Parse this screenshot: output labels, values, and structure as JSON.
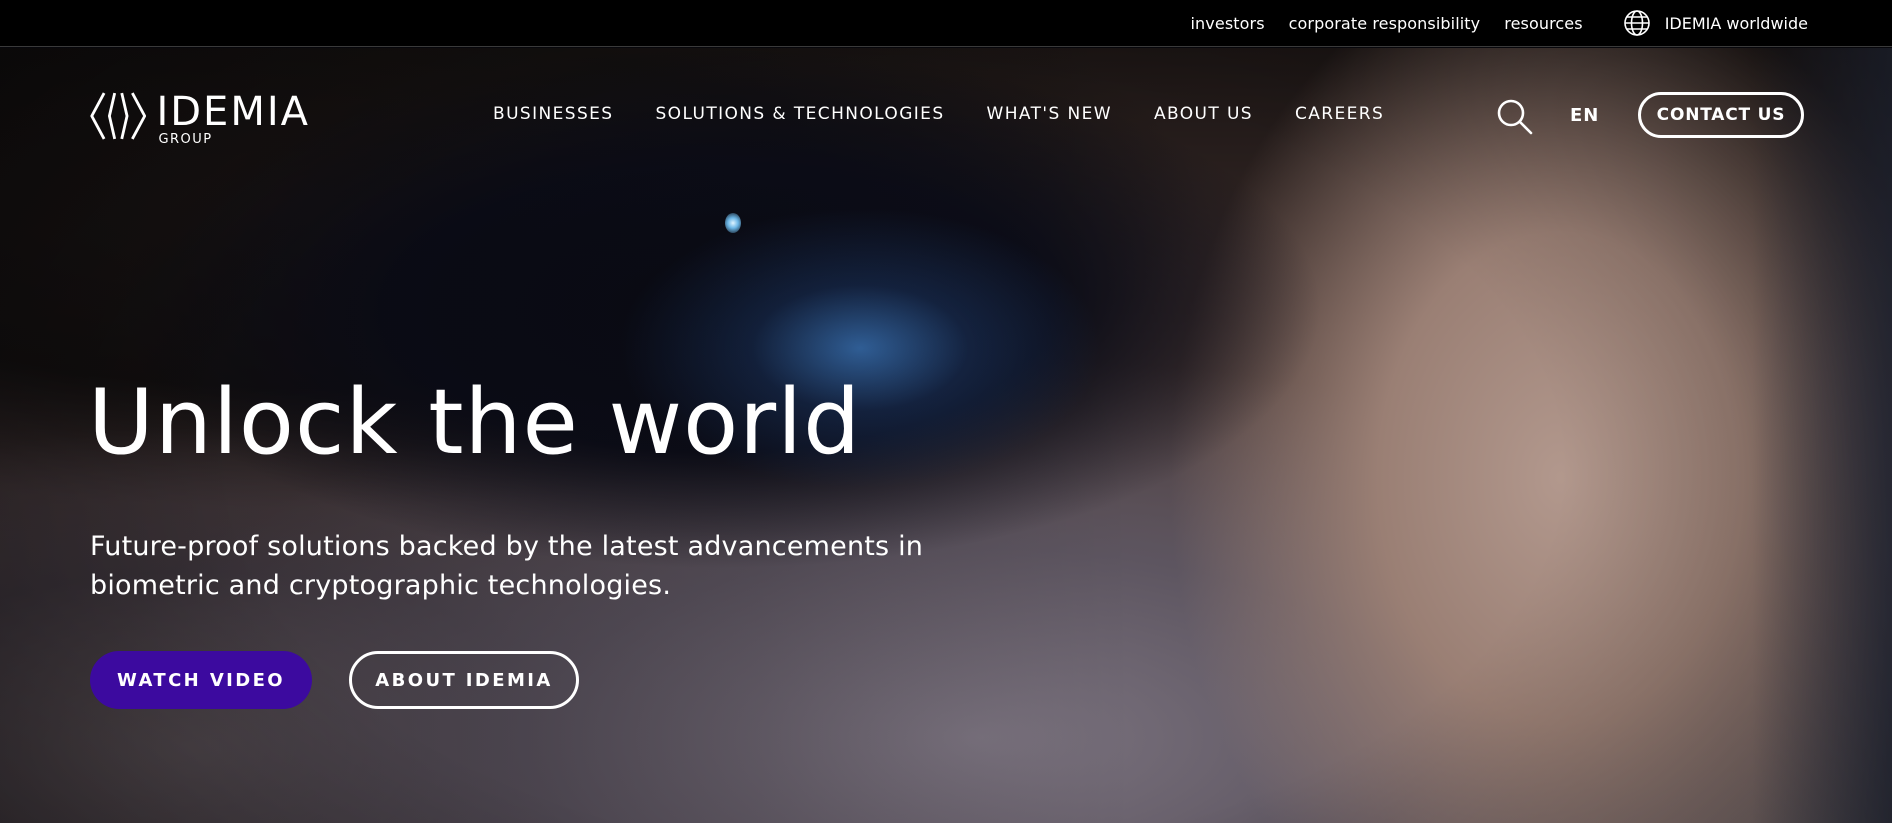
{
  "utility_bar": {
    "links": [
      "investors",
      "corporate responsibility",
      "resources"
    ],
    "worldwide": {
      "label": "IDEMIA worldwide",
      "icon": "globe-icon"
    }
  },
  "logo": {
    "name": "IDEMIA",
    "sub": "GROUP"
  },
  "nav": {
    "items": [
      "BUSINESSES",
      "SOLUTIONS & TECHNOLOGIES",
      "WHAT'S NEW",
      "ABOUT US",
      "CAREERS"
    ],
    "search_icon": "search-icon",
    "language": "EN",
    "contact": "CONTACT US"
  },
  "hero": {
    "title": "Unlock the world",
    "subtitle": "Future-proof solutions backed by the latest advancements in biometric and cryptographic technologies.",
    "primary_button": "WATCH VIDEO",
    "secondary_button": "ABOUT IDEMIA"
  },
  "colors": {
    "primary_button_bg": "#3c0a9f",
    "utility_bar_bg": "#000000"
  }
}
